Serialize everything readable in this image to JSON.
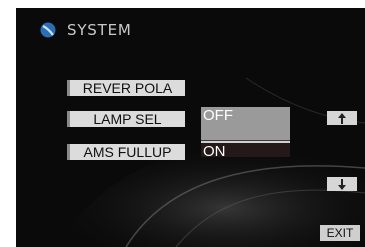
{
  "header": {
    "title": "SYSTEM",
    "logo_icon": "globe-logo-icon"
  },
  "menu": {
    "items": [
      {
        "label": "REVER POLA"
      },
      {
        "label": "LAMP SEL"
      },
      {
        "label": "AMS FULLUP"
      }
    ]
  },
  "dropdown": {
    "options": [
      {
        "label": "OFF",
        "selected": false
      },
      {
        "label": "ON",
        "selected": true
      }
    ]
  },
  "scroll": {
    "up_icon": "arrow-up-icon",
    "down_icon": "arrow-down-icon"
  },
  "footer": {
    "exit_label": "EXIT"
  },
  "colors": {
    "background": "#0a0a0a",
    "button": "#dcdcdc",
    "selected_option": "#241818",
    "highlight_option": "#9a9a9a"
  }
}
